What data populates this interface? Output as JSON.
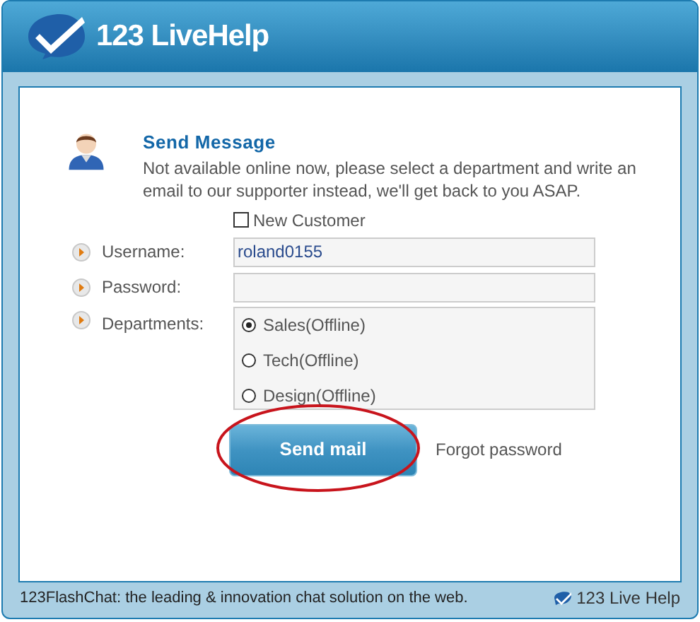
{
  "window": {
    "title": "123 LiveHelp"
  },
  "heading": "Send Message",
  "message": "Not available online now, please select a department and write an email to our supporter instead, we'll get back to you ASAP.",
  "new_customer": {
    "label": "New Customer",
    "checked": false
  },
  "fields": [
    {
      "label": "Username:",
      "value": "roland0155"
    },
    {
      "label": "Password:"
    }
  ],
  "departments": {
    "label": "Departments:",
    "options": [
      {
        "label": "Sales(Offline)",
        "selected": true
      },
      {
        "label": "Tech(Offline)",
        "selected": false
      },
      {
        "label": "Design(Offline)",
        "selected": false
      }
    ]
  },
  "send_button": "Send mail",
  "forgot_link": "Forgot password",
  "status_bar": {
    "text": "123FlashChat: the leading & innovation chat solution on the web.",
    "brand": "123 Live Help"
  }
}
